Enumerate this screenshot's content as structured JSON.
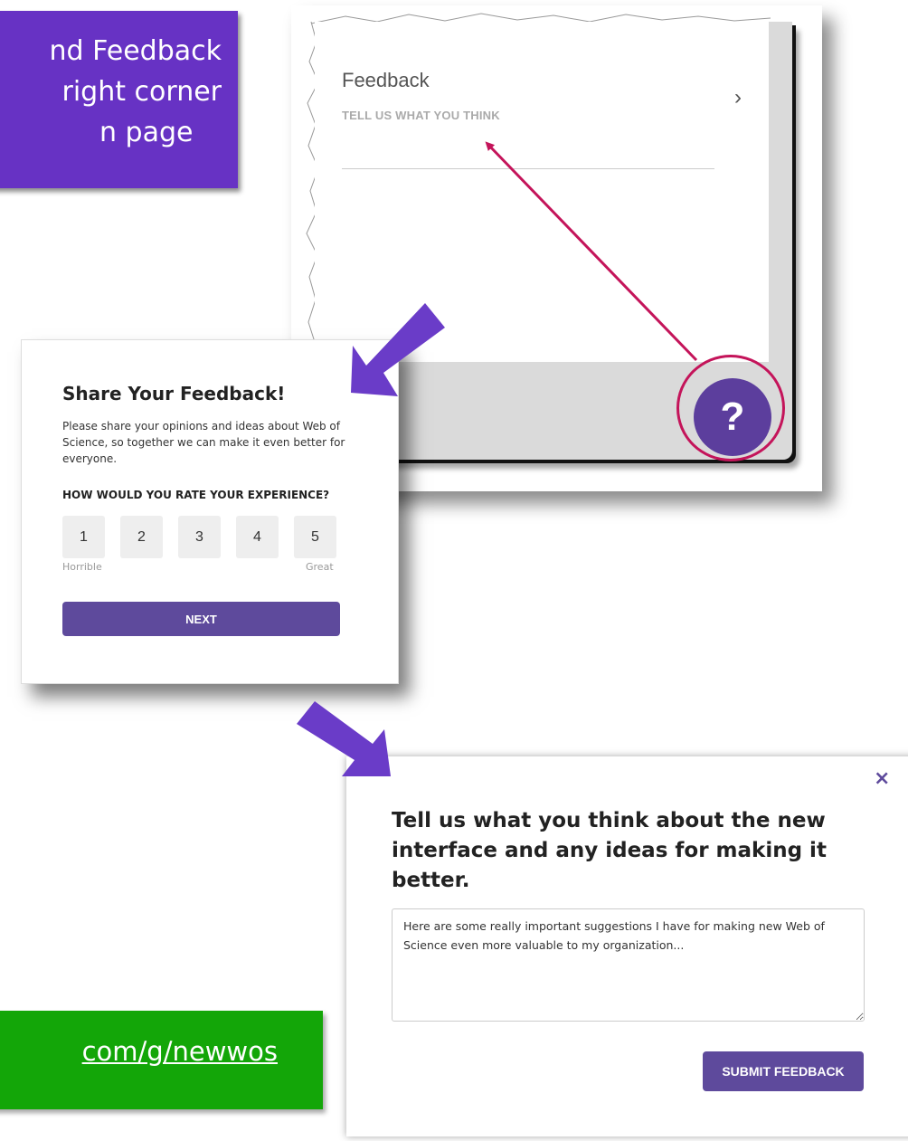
{
  "callout": {
    "line1": "nd Feedback",
    "line2": "right corner",
    "line3": "n page"
  },
  "link_box": {
    "url_text": "com/g/newwos"
  },
  "help_panel": {
    "feedback_title": "Feedback",
    "feedback_subtitle": "TELL US WHAT YOU THINK",
    "chevron": "›",
    "help_button_glyph": "?"
  },
  "share_feedback": {
    "title": "Share Your Feedback!",
    "description": "Please share your opinions and ideas about Web of Science, so together we can make it even better for everyone.",
    "question": "HOW WOULD YOU RATE YOUR EXPERIENCE?",
    "ratings": [
      "1",
      "2",
      "3",
      "4",
      "5"
    ],
    "low_label": "Horrible",
    "high_label": "Great",
    "next_label": "NEXT"
  },
  "tell_us": {
    "close_glyph": "×",
    "heading": "Tell us what you think about the new interface and any ideas for making it better.",
    "textarea_value": "Here are some really important suggestions I have for making new Web of Science even more valuable to my organization...",
    "submit_label": "SUBMIT FEEDBACK"
  },
  "colors": {
    "callout_purple": "#6732c4",
    "link_green": "#13a608",
    "brand_purple": "#5e4a9c",
    "highlight_pink": "#c4145a",
    "arrow_purple": "#6a3cc8"
  }
}
